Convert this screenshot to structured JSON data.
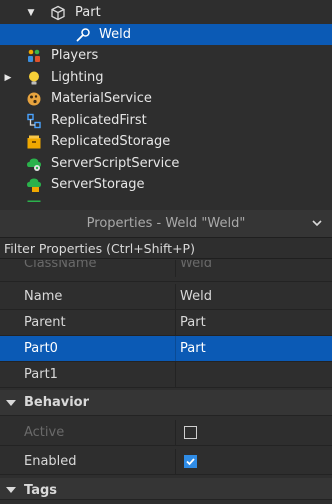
{
  "explorer": {
    "items": [
      {
        "label": "Part",
        "icon": "part-icon"
      },
      {
        "label": "Weld",
        "icon": "weld-icon"
      },
      {
        "label": "Players",
        "icon": "players-icon"
      },
      {
        "label": "Lighting",
        "icon": "lighting-icon"
      },
      {
        "label": "MaterialService",
        "icon": "material-service-icon"
      },
      {
        "label": "ReplicatedFirst",
        "icon": "replicated-first-icon"
      },
      {
        "label": "ReplicatedStorage",
        "icon": "replicated-storage-icon"
      },
      {
        "label": "ServerScriptService",
        "icon": "server-script-service-icon"
      },
      {
        "label": "ServerStorage",
        "icon": "server-storage-icon"
      }
    ]
  },
  "properties": {
    "title": "Properties - Weld \"Weld\"",
    "filter_placeholder": "Filter Properties (Ctrl+Shift+P)",
    "rows": [
      {
        "name": "ClassName",
        "value": "Weld"
      },
      {
        "name": "Name",
        "value": "Weld"
      },
      {
        "name": "Parent",
        "value": "Part"
      },
      {
        "name": "Part0",
        "value": "Part"
      },
      {
        "name": "Part1",
        "value": ""
      }
    ],
    "behavior": {
      "title": "Behavior",
      "active_label": "Active",
      "active_checked": false,
      "enabled_label": "Enabled",
      "enabled_checked": true
    },
    "tags_title": "Tags"
  },
  "colors": {
    "selection": "#0b5ab5",
    "background": "#2e2e2e",
    "checkbox_accent": "#2f8ce6"
  }
}
